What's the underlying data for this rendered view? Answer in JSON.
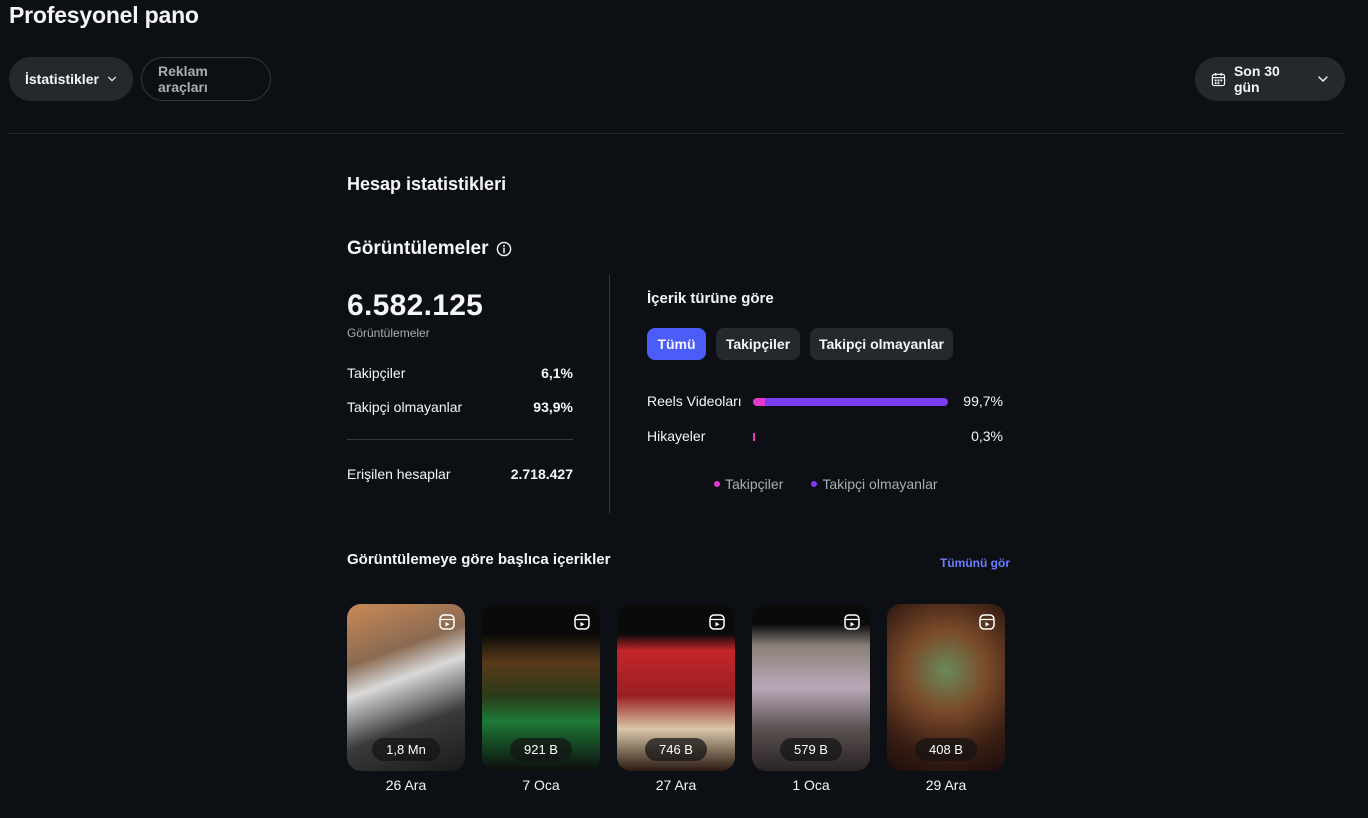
{
  "page_title": "Profesyonel pano",
  "toolbar": {
    "stats_label": "İstatistikler",
    "ads_label": "Reklam araçları",
    "range_label": "Son 30 gün"
  },
  "account": {
    "section_title": "Hesap istatistikleri",
    "views_title": "Görüntülemeler",
    "total_views": "6.582.125",
    "total_views_label": "Görüntülemeler",
    "followers_label": "Takipçiler",
    "followers_value": "6,1%",
    "non_followers_label": "Takipçi olmayanlar",
    "non_followers_value": "93,9%",
    "reached_label": "Erişilen hesaplar",
    "reached_value": "2.718.427"
  },
  "content_type": {
    "title": "İçerik türüne göre",
    "tabs": [
      {
        "label": "Tümü",
        "active": true
      },
      {
        "label": "Takipçiler",
        "active": false
      },
      {
        "label": "Takipçi olmayanlar",
        "active": false
      }
    ],
    "rows": [
      {
        "label": "Reels Videoları",
        "value": "99,7%",
        "total_fraction": 0.997,
        "followers_fraction": 0.061
      },
      {
        "label": "Hikayeler",
        "value": "0,3%",
        "total_fraction": 0.003,
        "followers_fraction": 1.0
      }
    ],
    "legend": [
      {
        "label": "Takipçiler",
        "color": "#e23ad1"
      },
      {
        "label": "Takipçi olmayanlar",
        "color": "#7b3cf2"
      }
    ]
  },
  "top_content": {
    "title": "Görüntülemeye göre başlıca içerikler",
    "see_all": "Tümünü gör",
    "items": [
      {
        "count": "1,8 Mn",
        "date": "26 Ara"
      },
      {
        "count": "921 B",
        "date": "7 Oca"
      },
      {
        "count": "746 B",
        "date": "27 Ara"
      },
      {
        "count": "579 B",
        "date": "1 Oca"
      },
      {
        "count": "408 B",
        "date": "29 Ara"
      }
    ]
  },
  "colors": {
    "accent": "#4a5df9",
    "followers": "#e23ad1",
    "non_followers": "#7b3cf2",
    "link": "#6a80ff"
  }
}
